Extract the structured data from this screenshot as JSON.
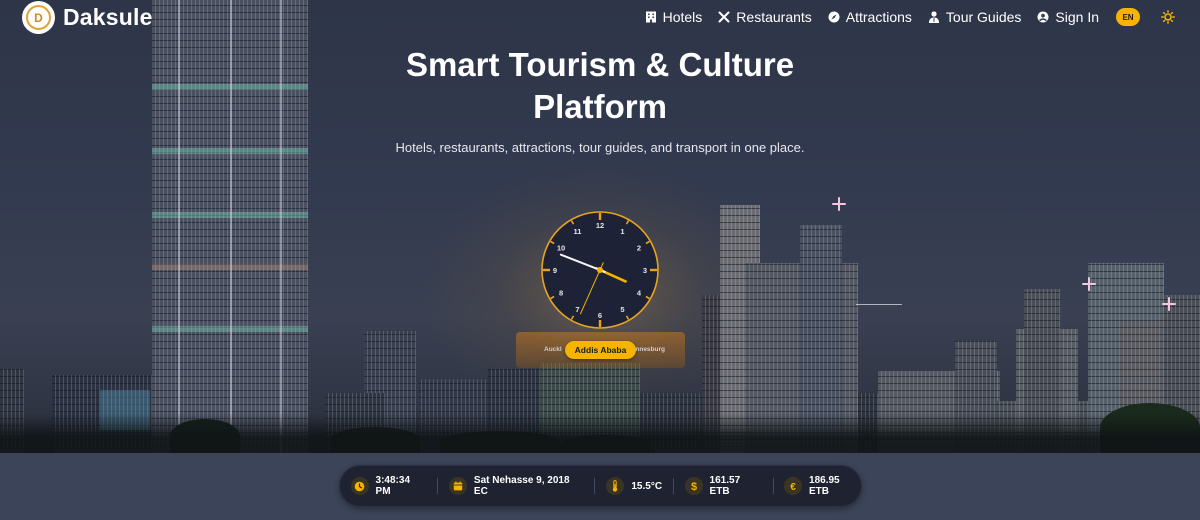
{
  "navbar": {
    "brand": "Daksule",
    "links": [
      {
        "label": "Hotels",
        "icon": "hotel-icon"
      },
      {
        "label": "Restaurants",
        "icon": "utensils-icon"
      },
      {
        "label": "Attractions",
        "icon": "compass-icon"
      },
      {
        "label": "Tour Guides",
        "icon": "guide-icon"
      },
      {
        "label": "Sign In",
        "icon": "user-circle-icon"
      }
    ],
    "language": "EN",
    "theme_icon": "sun-icon"
  },
  "hero": {
    "title": "Smart Tourism & Culture Platform",
    "subtitle": "Hotels, restaurants, attractions, tour guides, and transport in one place."
  },
  "clock": {
    "numbers": [
      "12",
      "1",
      "2",
      "3",
      "4",
      "5",
      "6",
      "7",
      "8",
      "9",
      "10",
      "11"
    ],
    "time": {
      "hour": 3,
      "minute": 48,
      "second": 34
    }
  },
  "timezones": {
    "left": "Auckl",
    "active": "Addis Ababa",
    "right": "nnesburg"
  },
  "info_bar": {
    "time": "3:48:34 PM",
    "date": "Sat Nehasse 9, 2018 EC",
    "temperature": "15.5°C",
    "usd_rate": "161.57 ETB",
    "eur_rate": "186.95 ETB"
  },
  "colors": {
    "accent": "#f5b400",
    "info_bar_bg": "#1f2230",
    "page_bg": "#3b4458"
  }
}
